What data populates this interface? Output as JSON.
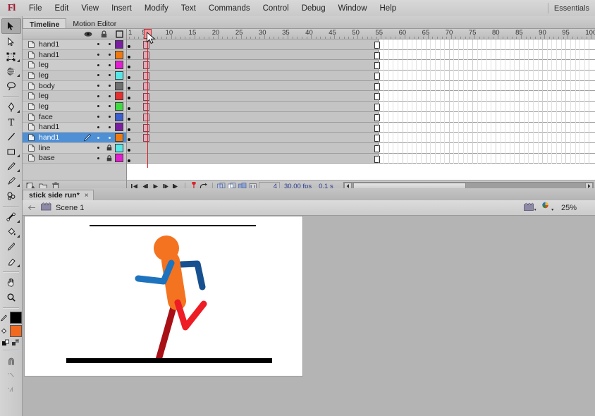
{
  "app": {
    "logo": "Fl",
    "workspace": "Essentials",
    "menus": [
      "File",
      "Edit",
      "View",
      "Insert",
      "Modify",
      "Text",
      "Commands",
      "Control",
      "Debug",
      "Window",
      "Help"
    ]
  },
  "toolbox": {
    "tools": [
      {
        "name": "selection-tool",
        "icon": "arrow",
        "selected": true,
        "submenu": false
      },
      {
        "name": "subselection-tool",
        "icon": "arrow-white",
        "selected": false,
        "submenu": false
      },
      {
        "name": "free-transform-tool",
        "icon": "transform",
        "selected": false,
        "submenu": true
      },
      {
        "name": "3d-rotation-tool",
        "icon": "sphere",
        "selected": false,
        "submenu": true
      },
      {
        "name": "lasso-tool",
        "icon": "lasso",
        "selected": false,
        "submenu": false
      },
      {
        "name": "pen-tool",
        "icon": "pen",
        "selected": false,
        "submenu": true
      },
      {
        "name": "text-tool",
        "icon": "text-T",
        "selected": false,
        "submenu": false
      },
      {
        "name": "line-tool",
        "icon": "line",
        "selected": false,
        "submenu": false
      },
      {
        "name": "rectangle-tool",
        "icon": "rectangle",
        "selected": false,
        "submenu": true
      },
      {
        "name": "pencil-tool",
        "icon": "pencil",
        "selected": false,
        "submenu": false
      },
      {
        "name": "brush-tool",
        "icon": "brush",
        "selected": false,
        "submenu": true
      },
      {
        "name": "deco-tool",
        "icon": "deco",
        "selected": false,
        "submenu": false
      },
      {
        "name": "bone-tool",
        "icon": "bone",
        "selected": false,
        "submenu": true
      },
      {
        "name": "paint-bucket-tool",
        "icon": "paint-bucket",
        "selected": false,
        "submenu": true
      },
      {
        "name": "eyedropper-tool",
        "icon": "eyedropper",
        "selected": false,
        "submenu": false
      },
      {
        "name": "eraser-tool",
        "icon": "eraser",
        "selected": false,
        "submenu": false
      },
      {
        "name": "hand-tool",
        "icon": "hand",
        "selected": false,
        "submenu": false
      },
      {
        "name": "zoom-tool",
        "icon": "magnifier",
        "selected": false,
        "submenu": false
      }
    ],
    "stroke_color": "#000000",
    "fill_color": "#f26a20"
  },
  "timeline": {
    "tabs": [
      {
        "label": "Timeline",
        "active": true
      },
      {
        "label": "Motion Editor",
        "active": false
      }
    ],
    "column_headers": [
      "eye-icon",
      "lock-icon",
      "outline-icon"
    ],
    "ruler": {
      "first_label": "1",
      "labels": [
        5,
        10,
        15,
        20,
        25,
        30,
        35,
        40,
        45,
        50,
        55,
        60,
        65,
        70,
        75,
        80,
        85,
        90,
        95,
        100
      ],
      "frames_visible": 100
    },
    "playhead_frame": 5,
    "span_end_frame": 54,
    "layers": [
      {
        "name": "hand1",
        "color": "#7a1fa2",
        "visible": true,
        "locked": false,
        "selected": false,
        "keyframes": [
          1,
          5
        ]
      },
      {
        "name": "hand1",
        "color": "#f07a10",
        "visible": true,
        "locked": false,
        "selected": false,
        "keyframes": [
          1,
          5
        ]
      },
      {
        "name": "leg",
        "color": "#e020d0",
        "visible": true,
        "locked": false,
        "selected": false,
        "keyframes": [
          1,
          5
        ]
      },
      {
        "name": "leg",
        "color": "#55e8e8",
        "visible": true,
        "locked": false,
        "selected": false,
        "keyframes": [
          1,
          5
        ]
      },
      {
        "name": "body",
        "color": "#707070",
        "visible": true,
        "locked": false,
        "selected": false,
        "keyframes": [
          1,
          5
        ]
      },
      {
        "name": "leg",
        "color": "#e63030",
        "visible": true,
        "locked": false,
        "selected": false,
        "keyframes": [
          1,
          5
        ]
      },
      {
        "name": "leg",
        "color": "#3fdb42",
        "visible": true,
        "locked": false,
        "selected": false,
        "keyframes": [
          1,
          5
        ]
      },
      {
        "name": "face",
        "color": "#3a5fd0",
        "visible": true,
        "locked": false,
        "selected": false,
        "keyframes": [
          1,
          5
        ]
      },
      {
        "name": "hand1",
        "color": "#7a1fa2",
        "visible": true,
        "locked": false,
        "selected": false,
        "keyframes": [
          1,
          5
        ]
      },
      {
        "name": "hand1",
        "color": "#f07a10",
        "visible": true,
        "locked": false,
        "selected": true,
        "keyframes": [
          1,
          5
        ]
      },
      {
        "name": "line",
        "color": "#55e8e8",
        "visible": true,
        "locked": true,
        "selected": false,
        "keyframes": [
          1
        ]
      },
      {
        "name": "base",
        "color": "#e020d0",
        "visible": true,
        "locked": true,
        "selected": false,
        "keyframes": [
          1
        ]
      }
    ],
    "layer_tools": [
      "new-layer-button",
      "new-folder-button",
      "delete-layer-button"
    ],
    "status": {
      "playback_buttons": [
        "go-to-first-frame",
        "step-back-one-frame",
        "play",
        "step-forward-one-frame",
        "go-to-last-frame"
      ],
      "onion_buttons": [
        "onion-skin",
        "onion-skin-outlines",
        "edit-multiple-frames",
        "modify-onion-markers"
      ],
      "current_frame": "4",
      "fps": "30.00 fps",
      "elapsed": "0.1 s"
    }
  },
  "document": {
    "tab_label": "stick side run*",
    "tab_close": "×",
    "scene_name": "Scene 1",
    "zoom": "25%",
    "edit_scene_icon": "edit-scene-icon",
    "edit_symbols_icon": "edit-symbols-icon"
  },
  "stage": {
    "background": "#ffffff",
    "art_name": "running-stick-figure",
    "colors": {
      "head": "#f47320",
      "body": "#f47320",
      "arm_front": "#1e73be",
      "arm_back": "#17508f",
      "leg_front": "#ee1c24",
      "leg_back": "#a81016",
      "ground": "#000000",
      "guide_line": "#000000"
    }
  }
}
